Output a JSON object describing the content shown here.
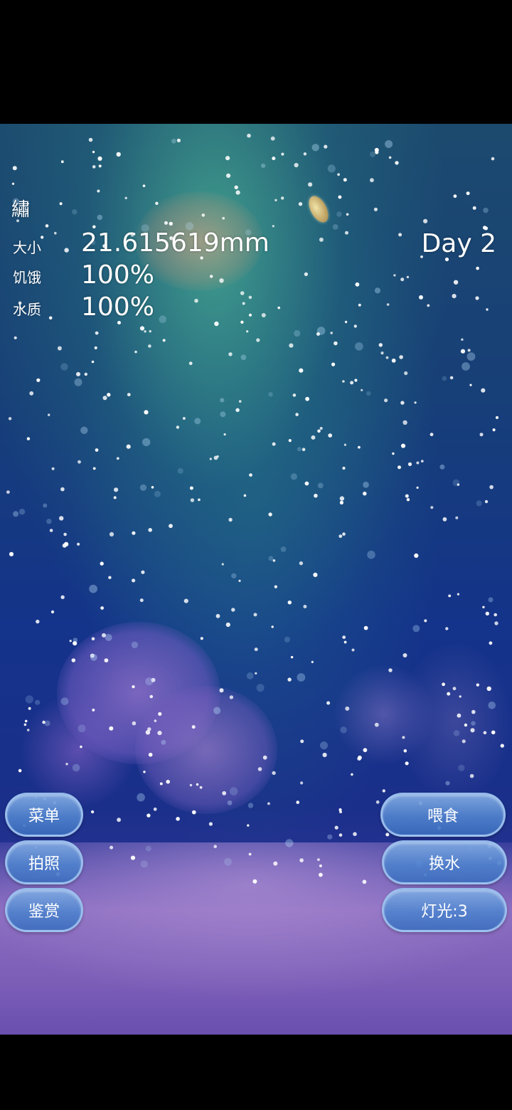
{
  "species_name": "繡",
  "stats": {
    "size_label": "大小",
    "size_value": "21.615619mm",
    "hunger_label": "饥饿",
    "hunger_value": "100%",
    "water_label": "水质",
    "water_value": "100%"
  },
  "day_counter": "Day 2",
  "buttons": {
    "menu": "菜单",
    "photo": "拍照",
    "appreciate": "鉴赏",
    "feed": "喂食",
    "change_water": "换水",
    "light": "灯光:3"
  },
  "colors": {
    "water_top": "#1c4a6e",
    "water_mid": "#14338a",
    "sand": "#7d5fb8",
    "button": "#5a8ed0",
    "button_border": "#a0c3f0",
    "text": "#ffffff"
  }
}
